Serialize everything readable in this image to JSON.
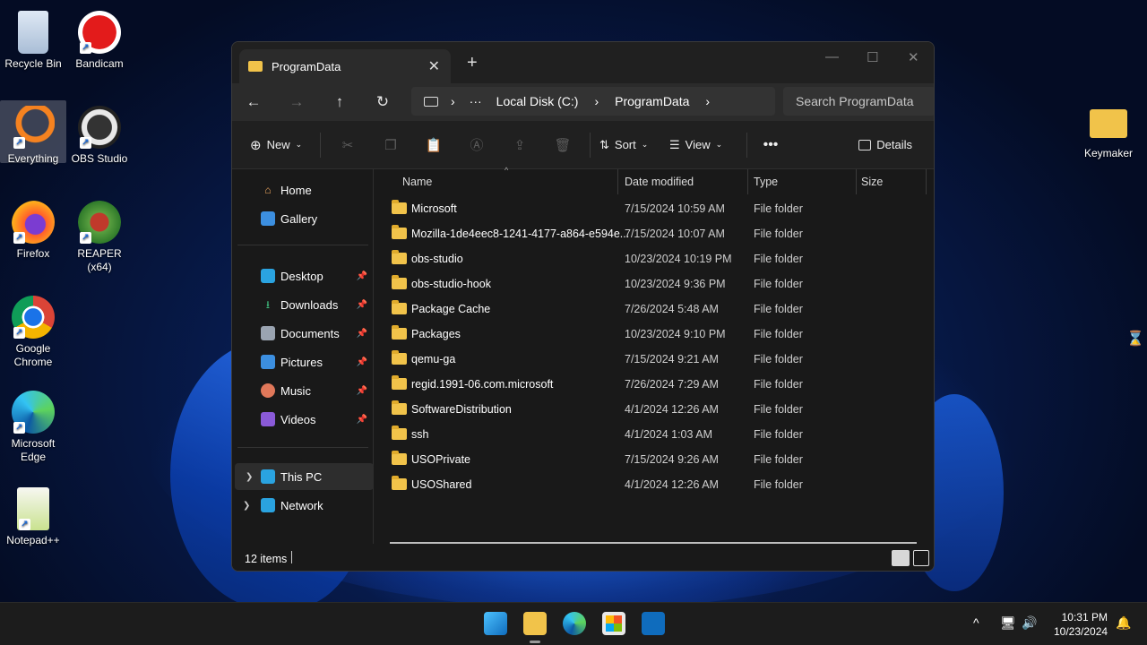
{
  "desktop": {
    "icons": [
      {
        "label": "Recycle Bin"
      },
      {
        "label": "Bandicam"
      },
      {
        "label": "Everything"
      },
      {
        "label": "OBS Studio"
      },
      {
        "label": "Firefox"
      },
      {
        "label": "REAPER (x64)"
      },
      {
        "label": "Google Chrome"
      },
      {
        "label": "Microsoft Edge"
      },
      {
        "label": "Notepad++"
      },
      {
        "label": "Keymaker"
      }
    ]
  },
  "window": {
    "tab_title": "ProgramData",
    "breadcrumb": [
      "Local Disk (C:)",
      "ProgramData"
    ],
    "search_placeholder": "Search ProgramData",
    "toolbar": {
      "new_label": "New",
      "sort_label": "Sort",
      "view_label": "View",
      "details_label": "Details"
    },
    "nav": {
      "home": "Home",
      "gallery": "Gallery",
      "pinned": [
        "Desktop",
        "Downloads",
        "Documents",
        "Pictures",
        "Music",
        "Videos"
      ],
      "this_pc": "This PC",
      "network": "Network"
    },
    "columns": [
      "Name",
      "Date modified",
      "Type",
      "Size"
    ],
    "files": [
      {
        "name": "Microsoft",
        "date": "7/15/2024 10:59 AM",
        "type": "File folder"
      },
      {
        "name": "Mozilla-1de4eec8-1241-4177-a864-e594e...",
        "date": "7/15/2024 10:07 AM",
        "type": "File folder"
      },
      {
        "name": "obs-studio",
        "date": "10/23/2024 10:19 PM",
        "type": "File folder"
      },
      {
        "name": "obs-studio-hook",
        "date": "10/23/2024 9:36 PM",
        "type": "File folder"
      },
      {
        "name": "Package Cache",
        "date": "7/26/2024 5:48 AM",
        "type": "File folder"
      },
      {
        "name": "Packages",
        "date": "10/23/2024 9:10 PM",
        "type": "File folder"
      },
      {
        "name": "qemu-ga",
        "date": "7/15/2024 9:21 AM",
        "type": "File folder"
      },
      {
        "name": "regid.1991-06.com.microsoft",
        "date": "7/26/2024 7:29 AM",
        "type": "File folder"
      },
      {
        "name": "SoftwareDistribution",
        "date": "4/1/2024 12:26 AM",
        "type": "File folder"
      },
      {
        "name": "ssh",
        "date": "4/1/2024 1:03 AM",
        "type": "File folder"
      },
      {
        "name": "USOPrivate",
        "date": "7/15/2024 9:26 AM",
        "type": "File folder"
      },
      {
        "name": "USOShared",
        "date": "4/1/2024 12:26 AM",
        "type": "File folder"
      }
    ],
    "status_text": "12 items"
  },
  "taskbar": {
    "time": "10:31 PM",
    "date": "10/23/2024"
  },
  "colors": {
    "folder": "#f1c34a",
    "accent": "#4cc2ff",
    "window_bg": "#191919"
  }
}
